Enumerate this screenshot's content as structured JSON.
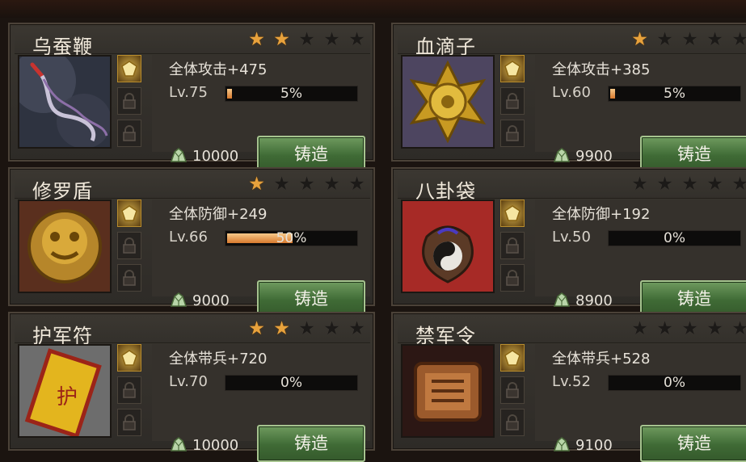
{
  "items": [
    {
      "name": "乌蚕鞭",
      "stars": 2,
      "stat": "全体攻击+475",
      "level": "Lv.75",
      "progress": 5,
      "progress_label": "5%",
      "cost": "10000",
      "forge_label": "铸造",
      "art": "whip"
    },
    {
      "name": "血滴子",
      "stars": 1,
      "stat": "全体攻击+385",
      "level": "Lv.60",
      "progress": 5,
      "progress_label": "5%",
      "cost": "9900",
      "forge_label": "铸造",
      "art": "disc"
    },
    {
      "name": "修罗盾",
      "stars": 1,
      "stat": "全体防御+249",
      "level": "Lv.66",
      "progress": 50,
      "progress_label": "50%",
      "cost": "9000",
      "forge_label": "铸造",
      "art": "shield"
    },
    {
      "name": "八卦袋",
      "stars": 0,
      "stat": "全体防御+192",
      "level": "Lv.50",
      "progress": 0,
      "progress_label": "0%",
      "cost": "8900",
      "forge_label": "铸造",
      "art": "bag"
    },
    {
      "name": "护军符",
      "stars": 2,
      "stat": "全体带兵+720",
      "level": "Lv.70",
      "progress": 0,
      "progress_label": "0%",
      "cost": "10000",
      "forge_label": "铸造",
      "art": "talisman"
    },
    {
      "name": "禁军令",
      "stars": 0,
      "stat": "全体带兵+528",
      "level": "Lv.52",
      "progress": 0,
      "progress_label": "0%",
      "cost": "9100",
      "forge_label": "铸造",
      "art": "token"
    }
  ],
  "colors": {
    "star_on": "#e8a23c",
    "star_off": "#1c1a18",
    "forge_button": "#4f7d43",
    "progress_fill": "#e2913f"
  },
  "icons": {
    "star": "star-icon",
    "gem": "gem-icon",
    "lock": "lock-icon",
    "currency": "ore-icon"
  }
}
